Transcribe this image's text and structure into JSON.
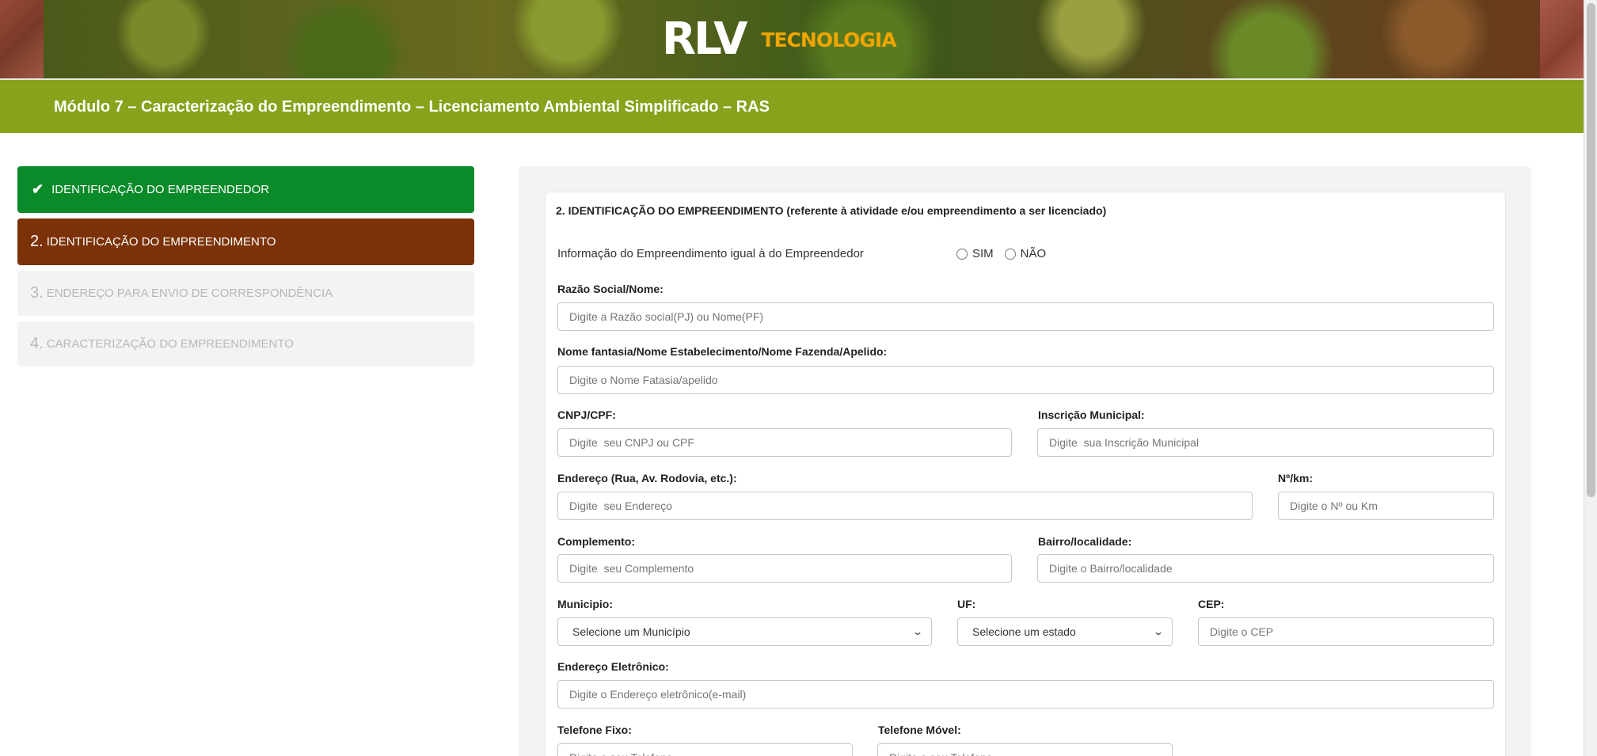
{
  "header": {
    "logo_main": "RLV",
    "logo_sub": "TECNOLOGIA"
  },
  "titlebar": {
    "title": "Módulo 7 – Caracterização do Empreendimento – Licenciamento Ambiental Simplificado – RAS"
  },
  "stepper": {
    "items": [
      {
        "num": "",
        "label": "Identificação do Empreendedor",
        "state": "done"
      },
      {
        "num": "2.",
        "label": "Identificação do Empreendimento",
        "state": "active"
      },
      {
        "num": "3.",
        "label": "Endereço para envio de correspondência",
        "state": "todo"
      },
      {
        "num": "4.",
        "label": "Caracterização do Empreendimento",
        "state": "todo"
      }
    ]
  },
  "form": {
    "section_title": "2. IDENTIFICAÇÃO DO EMPREENDIMENTO (referente à atividade e/ou empreendimento a ser licenciado)",
    "same_info_question": "Informação do Empreendimento igual à do Empreendedor",
    "radio_yes": "SIM",
    "radio_no": "NÃO",
    "razao_label": "Razão Social/Nome:",
    "razao_placeholder": "Digite a Razão social(PJ) ou Nome(PF)",
    "fantasia_label": "Nome fantasia/Nome Estabelecimento/Nome Fazenda/Apelido:",
    "fantasia_placeholder": "Digite o Nome Fatasia/apelido",
    "cnpj_label": "CNPJ/CPF:",
    "cnpj_placeholder": "Digite  seu CNPJ ou CPF",
    "inscricao_label": "Inscrição Municipal:",
    "inscricao_placeholder": "Digite  sua Inscrição Municipal",
    "endereco_label": "Endereço (Rua, Av. Rodovia, etc.):",
    "endereco_placeholder": "Digite  seu Endereço",
    "numero_label": "Nº/km:",
    "numero_placeholder": "Digite o Nº ou Km",
    "complemento_label": "Complemento:",
    "complemento_placeholder": "Digite  seu Complemento",
    "bairro_label": "Bairro/localidade:",
    "bairro_placeholder": "Digite o Bairro/localidade",
    "municipio_label": "Municipio:",
    "municipio_selected": "Selecione um Município",
    "uf_label": "UF:",
    "uf_selected": "Selecione um estado",
    "cep_label": "CEP:",
    "cep_placeholder": "Digite o CEP",
    "email_label": "Endereço Eletrônico:",
    "email_placeholder": "Digite o Endereço eletrônico(e-mail)",
    "fixo_label": "Telefone Fixo:",
    "fixo_placeholder": "Digite o seu Telefone",
    "movel_label": "Telefone Móvel:",
    "movel_placeholder": "Digite o seu Telefone"
  },
  "icons": {
    "check": "check-icon",
    "chevron": "chevron-down-icon"
  },
  "colors": {
    "title_bar": "#86a31b",
    "step_done": "#0b8a2a",
    "step_active": "#7b3208",
    "logo_accent": "#f0a500"
  }
}
